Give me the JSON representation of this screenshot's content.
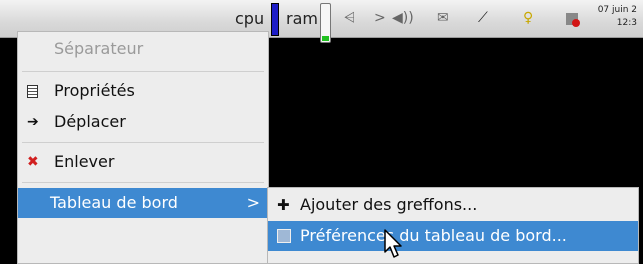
{
  "panel": {
    "cpu_label": "cpu",
    "ram_label": "ram",
    "tray": {
      "network": "⩤",
      "chevron": ">",
      "volume": "◀))",
      "mail": "✉",
      "plug": "⟋",
      "bulb": "♀"
    },
    "clock_date": "07 juin 2",
    "clock_time": "12:3"
  },
  "menu": {
    "items": [
      {
        "label": "Séparateur",
        "icon": "",
        "disabled": true
      },
      {
        "label": "Propriétés",
        "icon": "properties-icon"
      },
      {
        "label": "Déplacer",
        "icon": "move-arrow-icon"
      },
      {
        "label": "Enlever",
        "icon": "remove-x-icon"
      },
      {
        "label": "Tableau de bord",
        "icon": "",
        "submenu_arrow": ">"
      }
    ]
  },
  "submenu": {
    "items": [
      {
        "label": "Ajouter des greffons...",
        "icon": "plus-icon"
      },
      {
        "label": "Préférences du tableau de bord...",
        "icon": "preferences-icon"
      }
    ]
  },
  "colors": {
    "highlight": "#3e89d1",
    "cpu_bar": "#1d1dc7",
    "ram_fill": "#1fc01f"
  }
}
